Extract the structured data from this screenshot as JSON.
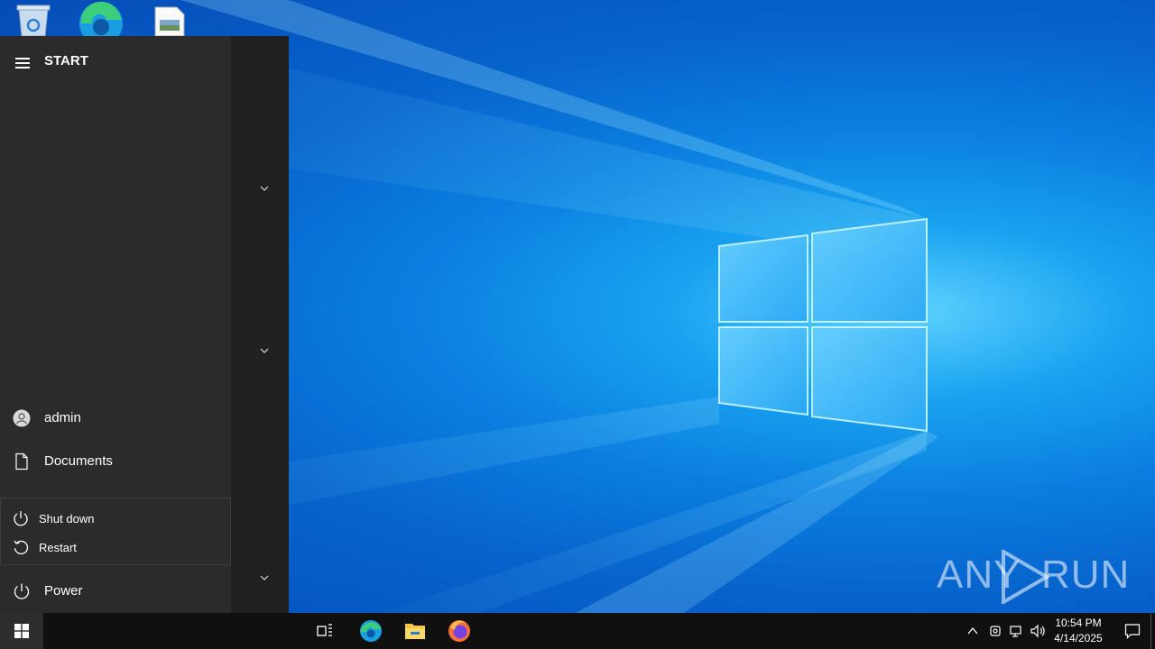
{
  "desktop": {
    "icons": [
      "recycle-bin-icon",
      "edge-icon",
      "document-icon"
    ],
    "watermark": {
      "left": "ANY",
      "right": "RUN"
    }
  },
  "start_menu": {
    "title": "START",
    "user": "admin",
    "documents": "Documents",
    "power": "Power",
    "power_flyout": {
      "shutdown": "Shut down",
      "restart": "Restart"
    }
  },
  "taskbar": {
    "pinned": [
      "task-view-icon",
      "edge-icon",
      "file-explorer-icon",
      "firefox-icon"
    ],
    "clock": {
      "time": "10:54 PM",
      "date": "4/14/2025"
    }
  },
  "colors": {
    "start_bg": "#202020",
    "start_panel": "#2b2b2b",
    "taskbar_bg": "#101010",
    "accent": "#0078d7"
  }
}
